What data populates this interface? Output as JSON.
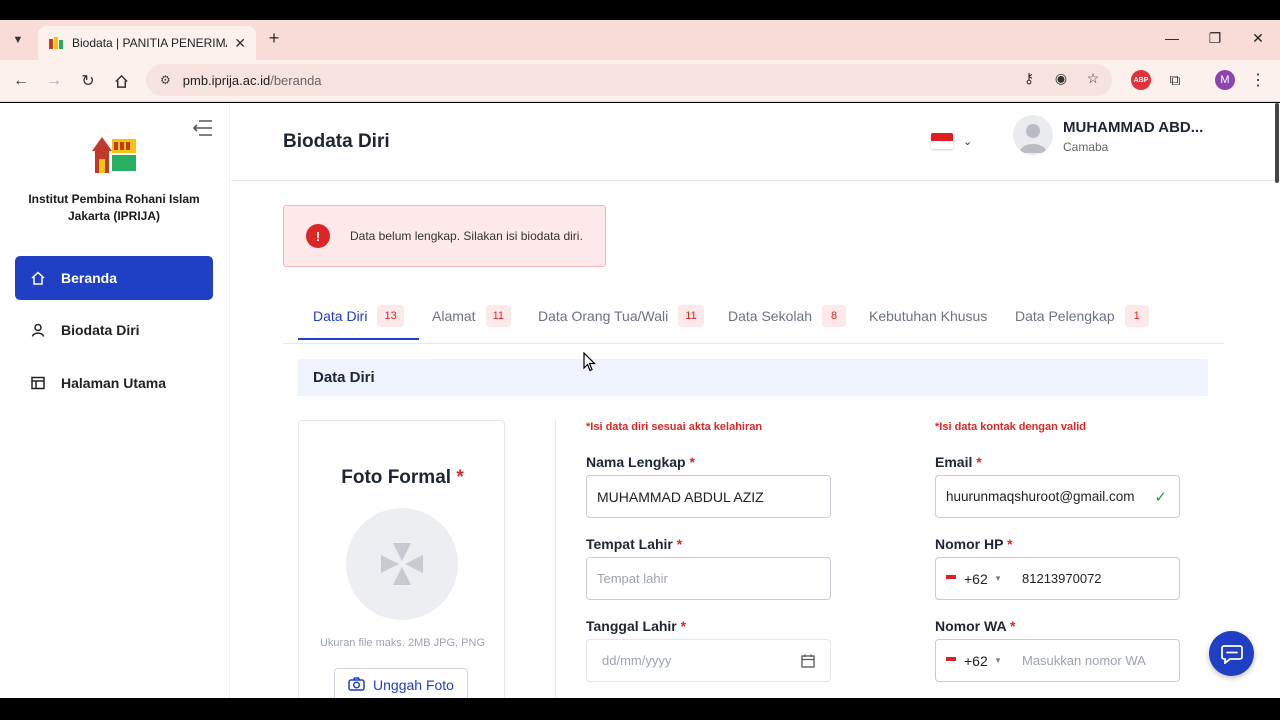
{
  "browser": {
    "tab_title": "Biodata | PANITIA PENERIMAAN",
    "url_host": "pmb.iprija.ac.id",
    "url_path": "/beranda",
    "profile_initial": "M",
    "abp_label": "ABP"
  },
  "sidebar": {
    "institution": "Institut Pembina Rohani Islam Jakarta (IPRIJA)",
    "items": [
      {
        "label": "Beranda",
        "icon": "home-icon",
        "active": true
      },
      {
        "label": "Biodata Diri",
        "icon": "user-icon",
        "active": false
      },
      {
        "label": "Halaman Utama",
        "icon": "layout-icon",
        "active": false
      }
    ]
  },
  "header": {
    "title": "Biodata Diri",
    "user_name": "MUHAMMAD ABD...",
    "user_role": "Camaba"
  },
  "alert": {
    "icon_text": "!",
    "text": "Data belum lengkap. Silakan isi biodata diri."
  },
  "tabs": [
    {
      "label": "Data Diri",
      "count": "13",
      "active": true
    },
    {
      "label": "Alamat",
      "count": "11"
    },
    {
      "label": "Data Orang Tua/Wali",
      "count": "11"
    },
    {
      "label": "Data Sekolah",
      "count": "8"
    },
    {
      "label": "Kebutuhan Khusus",
      "count": ""
    },
    {
      "label": "Data Pelengkap",
      "count": "1"
    }
  ],
  "section": {
    "title": "Data Diri"
  },
  "photo": {
    "title": "Foto Formal",
    "required": "*",
    "hint": "Ukuran file maks. 2MB JPG, PNG",
    "upload_label": "Unggah Foto"
  },
  "form_left": {
    "note": "*Isi data diri sesuai akta kelahiran",
    "full_name_label": "Nama Lengkap",
    "full_name_value": "MUHAMMAD ABDUL AZIZ",
    "birthplace_label": "Tempat Lahir",
    "birthplace_placeholder": "Tempat lahir",
    "birthdate_label": "Tanggal Lahir",
    "birthdate_placeholder": "dd/mm/yyyy"
  },
  "form_right": {
    "note": "*Isi data kontak dengan valid",
    "email_label": "Email",
    "email_value": "huurunmaqshuroot@gmail.com",
    "phone_label": "Nomor HP",
    "phone_code": "+62",
    "phone_value": "81213970072",
    "wa_label": "Nomor WA",
    "wa_code": "+62",
    "wa_placeholder": "Masukkan nomor WA"
  },
  "colors": {
    "primary": "#1f3fc4",
    "danger": "#dc2626",
    "tab_bar": "#f9dcd6"
  }
}
